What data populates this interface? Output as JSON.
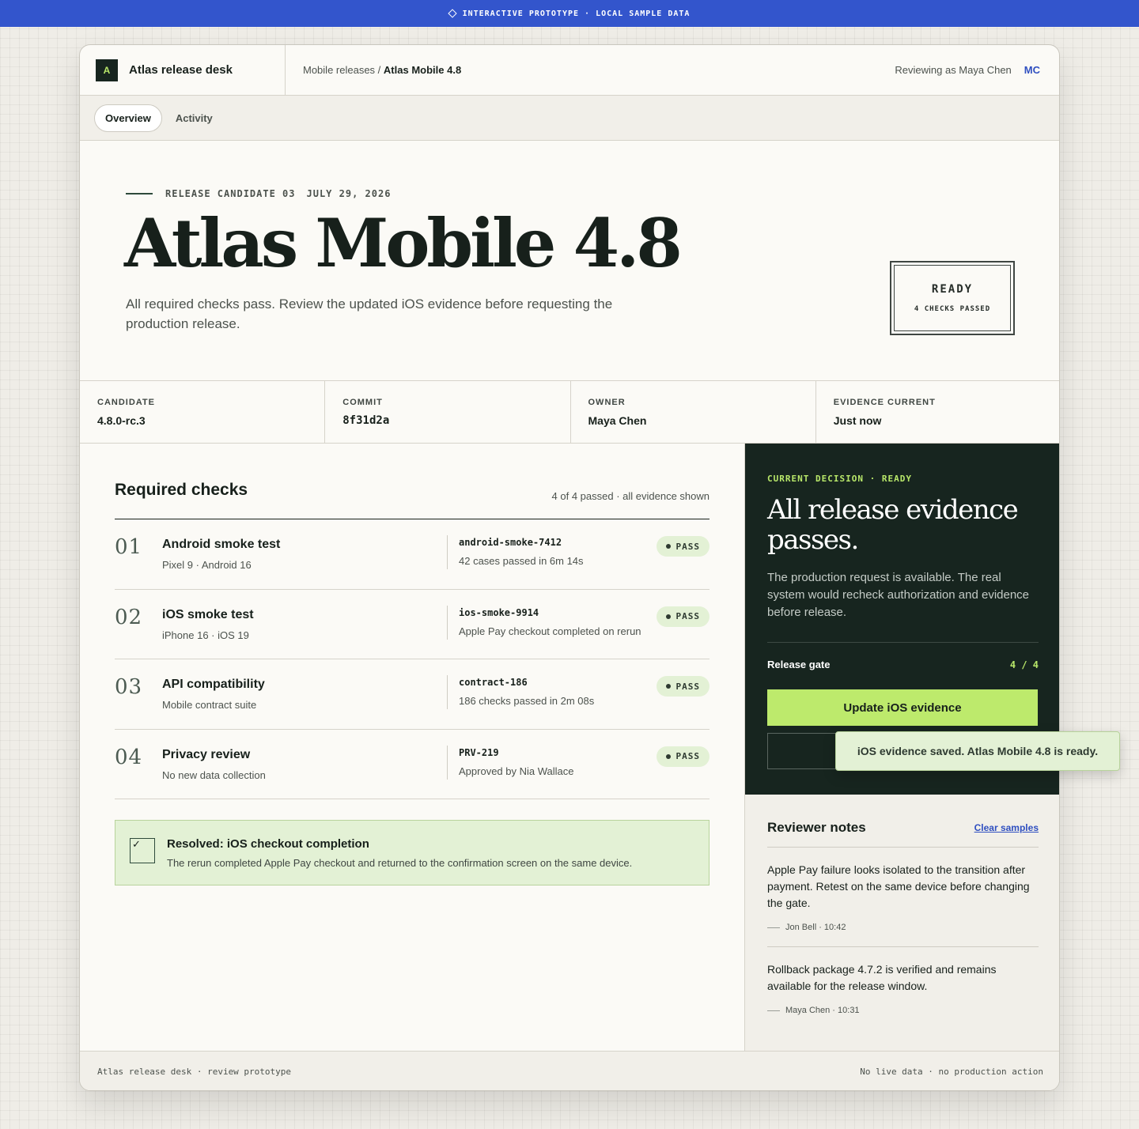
{
  "banner": {
    "icon": "diamond-icon",
    "text": "Interactive prototype · local sample data"
  },
  "header": {
    "logo_letter": "A",
    "app_name": "Atlas release desk",
    "breadcrumb_parent": "Mobile releases",
    "breadcrumb_sep": "/",
    "breadcrumb_current": "Atlas Mobile 4.8",
    "reviewer": "Reviewing as Maya Chen",
    "avatar": "MC"
  },
  "tabs": [
    {
      "label": "Overview",
      "active": true
    },
    {
      "label": "Activity",
      "active": false
    }
  ],
  "hero": {
    "candidate_label": "RELEASE CANDIDATE 03",
    "date": "JULY 29, 2026",
    "title": "Atlas Mobile 4.8",
    "subtitle": "All required checks pass. Review the updated iOS evidence before requesting the production release.",
    "stamp_status": "READY",
    "stamp_detail": "4 CHECKS PASSED"
  },
  "meta": [
    {
      "label": "Candidate",
      "value": "4.8.0-rc.3",
      "mono": false
    },
    {
      "label": "Commit",
      "value": "8f31d2a",
      "mono": true
    },
    {
      "label": "Owner",
      "value": "Maya Chen",
      "mono": false
    },
    {
      "label": "Evidence current",
      "value": "Just now",
      "mono": false
    }
  ],
  "checks": {
    "title": "Required checks",
    "summary": "4 of 4 passed · all evidence shown",
    "items": [
      {
        "num": "01",
        "name": "Android smoke test",
        "desc": "Pixel 9 · Android 16",
        "id": "android-smoke-7412",
        "result": "42 cases passed in 6m 14s",
        "status": "PASS"
      },
      {
        "num": "02",
        "name": "iOS smoke test",
        "desc": "iPhone 16 · iOS 19",
        "id": "ios-smoke-9914",
        "result": "Apple Pay checkout completed on rerun",
        "status": "PASS"
      },
      {
        "num": "03",
        "name": "API compatibility",
        "desc": "Mobile contract suite",
        "id": "contract-186",
        "result": "186 checks passed in 2m 08s",
        "status": "PASS"
      },
      {
        "num": "04",
        "name": "Privacy review",
        "desc": "No new data collection",
        "id": "PRV-219",
        "result": "Approved by Nia Wallace",
        "status": "PASS"
      }
    ]
  },
  "resolved": {
    "check": "✓",
    "title": "Resolved: iOS checkout completion",
    "text": "The rerun completed Apple Pay checkout and returned to the confirmation screen on the same device."
  },
  "decision": {
    "eyebrow": "CURRENT DECISION · READY",
    "title": "All release evidence passes.",
    "text": "The production request is available. The real system would recheck authorization and evidence before release.",
    "gate_label": "Release gate",
    "gate_value": "4 / 4",
    "primary_button": "Update iOS evidence"
  },
  "toast": "iOS evidence saved. Atlas Mobile 4.8 is ready.",
  "notes": {
    "title": "Reviewer notes",
    "clear_label": "Clear samples",
    "items": [
      {
        "text": "Apple Pay failure looks isolated to the transition after payment. Retest on the same device before changing the gate.",
        "author": "Jon Bell · 10:42"
      },
      {
        "text": "Rollback package 4.7.2 is verified and remains available for the release window.",
        "author": "Maya Chen · 10:31"
      }
    ]
  },
  "footer": {
    "left": "Atlas release desk · review prototype",
    "right": "No live data · no production action"
  },
  "colors": {
    "accent": "#3355cc",
    "brand_dark": "#17251f",
    "lime": "#bdea6c",
    "pass_bg": "#e3f1d5"
  }
}
